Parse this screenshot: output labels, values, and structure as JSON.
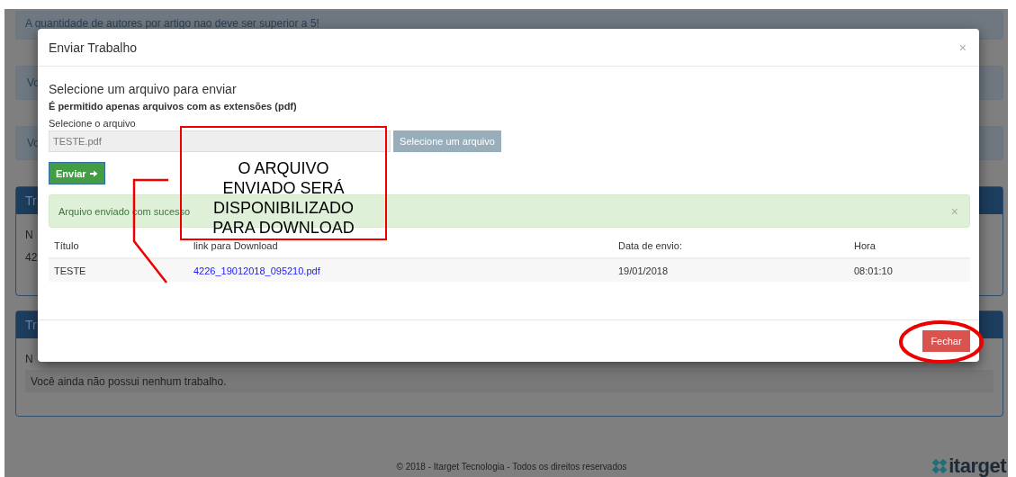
{
  "background_page": {
    "alerts": [
      "A quantidade de autores por artigo nao deve ser superior a 5!",
      "Vo",
      "Vo"
    ],
    "panels": [
      {
        "title": "Tr",
        "rows": [
          "N",
          "42"
        ]
      },
      {
        "title": "Tr",
        "rows": [
          "N",
          "Você ainda não possui nenhum trabalho."
        ]
      }
    ],
    "footer": "© 2018 - Itarget Tecnologia - Todos os direitos reservados",
    "logo": "itarget"
  },
  "modal": {
    "title": "Enviar Trabalho",
    "close": "×",
    "heading": "Selecione um arquivo para enviar",
    "note": "É permitido apenas arquivos com as extensões (pdf)",
    "file_label": "Selecione o arquivo",
    "file_value": "TESTE.pdf",
    "browse_button": "Selecione um arquivo",
    "send_button": "Enviar",
    "success": {
      "text": "Arquivo enviado com sucesso",
      "close": "×"
    },
    "table": {
      "columns": [
        "Título",
        "link para Download",
        "Data de envio:",
        "Hora"
      ],
      "rows": [
        {
          "title": "TESTE",
          "link": "4226_19012018_095210.pdf",
          "date": "19/01/2018",
          "time": "08:01:10"
        }
      ]
    },
    "footer_button": "Fechar"
  },
  "annotations": [
    {
      "kind": "callout",
      "lines": [
        "O ARQUIVO",
        "ENVIADO SERÁ",
        "DISPONIBILIZADO",
        "PARA DOWNLOAD"
      ]
    },
    {
      "kind": "ellipse"
    }
  ]
}
